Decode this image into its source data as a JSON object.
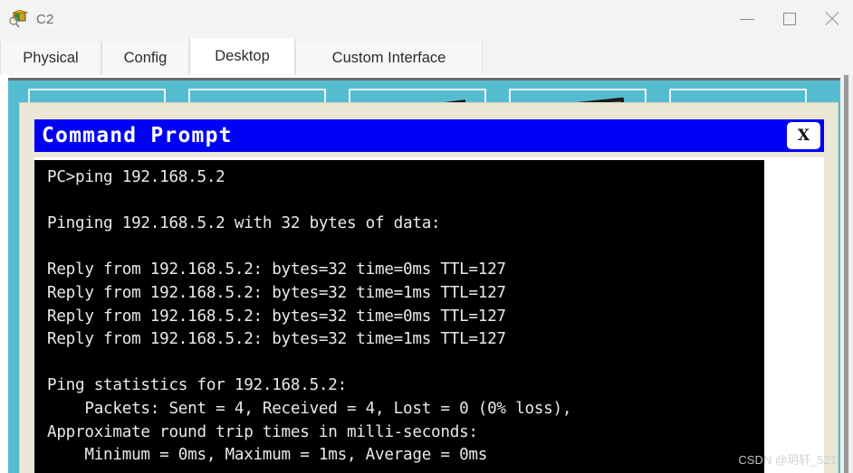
{
  "window": {
    "title": "C2",
    "icon": "packet-tracer-device-icon",
    "controls": {
      "minimize": "minimize-icon",
      "maximize": "maximize-icon",
      "close": "close-icon"
    }
  },
  "tabs": [
    {
      "label": "Physical",
      "active": false
    },
    {
      "label": "Config",
      "active": false
    },
    {
      "label": "Desktop",
      "active": true
    },
    {
      "label": "Custom Interface",
      "active": false
    }
  ],
  "desktop": {
    "background_color": "#55bcd0",
    "icons": [
      {
        "name": "ip-configuration-icon"
      },
      {
        "name": "text-editor-icon"
      },
      {
        "name": "command-prompt-icon"
      },
      {
        "name": "web-browser-icon"
      },
      {
        "name": "cloud-icon"
      }
    ]
  },
  "command_prompt": {
    "title": "Command Prompt",
    "close_label": "X",
    "title_bar_color": "#0000f4",
    "screen_bg": "#000000",
    "text_color": "#e9e9e9",
    "lines": [
      "PC>ping 192.168.5.2",
      "",
      "Pinging 192.168.5.2 with 32 bytes of data:",
      "",
      "Reply from 192.168.5.2: bytes=32 time=0ms TTL=127",
      "Reply from 192.168.5.2: bytes=32 time=1ms TTL=127",
      "Reply from 192.168.5.2: bytes=32 time=0ms TTL=127",
      "Reply from 192.168.5.2: bytes=32 time=1ms TTL=127",
      "",
      "Ping statistics for 192.168.5.2:",
      "    Packets: Sent = 4, Received = 4, Lost = 0 (0% loss),",
      "Approximate round trip times in milli-seconds:",
      "    Minimum = 0ms, Maximum = 1ms, Average = 0ms"
    ],
    "output_text": "PC>ping 192.168.5.2\n\nPinging 192.168.5.2 with 32 bytes of data:\n\nReply from 192.168.5.2: bytes=32 time=0ms TTL=127\nReply from 192.168.5.2: bytes=32 time=1ms TTL=127\nReply from 192.168.5.2: bytes=32 time=0ms TTL=127\nReply from 192.168.5.2: bytes=32 time=1ms TTL=127\n\nPing statistics for 192.168.5.2:\n    Packets: Sent = 4, Received = 4, Lost = 0 (0% loss),\nApproximate round trip times in milli-seconds:\n    Minimum = 0ms, Maximum = 1ms, Average = 0ms"
  },
  "watermark": {
    "text": "CSDN @玥轩_521"
  }
}
